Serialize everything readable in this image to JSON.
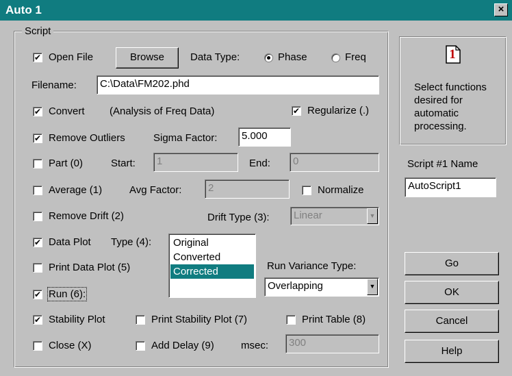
{
  "window": {
    "title": "Auto 1",
    "close_label": "×"
  },
  "script_group": {
    "label": "Script"
  },
  "open_file": {
    "checked": true,
    "label": "Open File",
    "browse_label": "Browse"
  },
  "data_type": {
    "label": "Data Type:",
    "options": [
      "Phase",
      "Freq"
    ],
    "selected": "Phase"
  },
  "filename": {
    "label": "Filename:",
    "value": "C:\\Data\\FM202.phd"
  },
  "convert": {
    "checked": true,
    "label": "Convert",
    "note": "(Analysis of Freq Data)"
  },
  "regularize": {
    "checked": true,
    "label": "Regularize (.)"
  },
  "remove_outliers": {
    "checked": true,
    "label": "Remove Outliers",
    "sigma_label": "Sigma Factor:",
    "sigma_value": "5.000"
  },
  "part": {
    "checked": false,
    "label": "Part (0)",
    "start_label": "Start:",
    "start_value": "1",
    "end_label": "End:",
    "end_value": "0"
  },
  "average": {
    "checked": false,
    "label": "Average (1)",
    "factor_label": "Avg Factor:",
    "factor_value": "2"
  },
  "normalize": {
    "checked": false,
    "label": "Normalize"
  },
  "remove_drift": {
    "checked": false,
    "label": "Remove Drift (2)",
    "drift_type_label": "Drift Type (3):",
    "drift_type_value": "Linear"
  },
  "data_plot": {
    "checked": true,
    "label": "Data Plot",
    "type_label": "Type (4):",
    "type_options": [
      "Original",
      "Converted",
      "Corrected"
    ],
    "type_selected": "Corrected"
  },
  "print_data_plot": {
    "checked": false,
    "label": "Print Data Plot (5)"
  },
  "run_variance": {
    "label": "Run Variance Type:",
    "value": "Overlapping"
  },
  "run": {
    "checked": true,
    "label": "Run (6):"
  },
  "stability_plot": {
    "checked": true,
    "label": "Stability Plot"
  },
  "print_stability_plot": {
    "checked": false,
    "label": "Print Stability Plot (7)"
  },
  "print_table": {
    "checked": false,
    "label": "Print Table (8)"
  },
  "close": {
    "checked": false,
    "label": "Close (X)"
  },
  "add_delay": {
    "checked": false,
    "label": "Add Delay (9)",
    "msec_label": "msec:",
    "msec_value": "300"
  },
  "info": {
    "icon_text": "1",
    "text": "Select functions desired for automatic processing."
  },
  "script_name": {
    "label": "Script #1 Name",
    "value": "AutoScript1"
  },
  "buttons": {
    "go": "Go",
    "ok": "OK",
    "cancel": "Cancel",
    "help": "Help"
  },
  "check_mark": "✔"
}
